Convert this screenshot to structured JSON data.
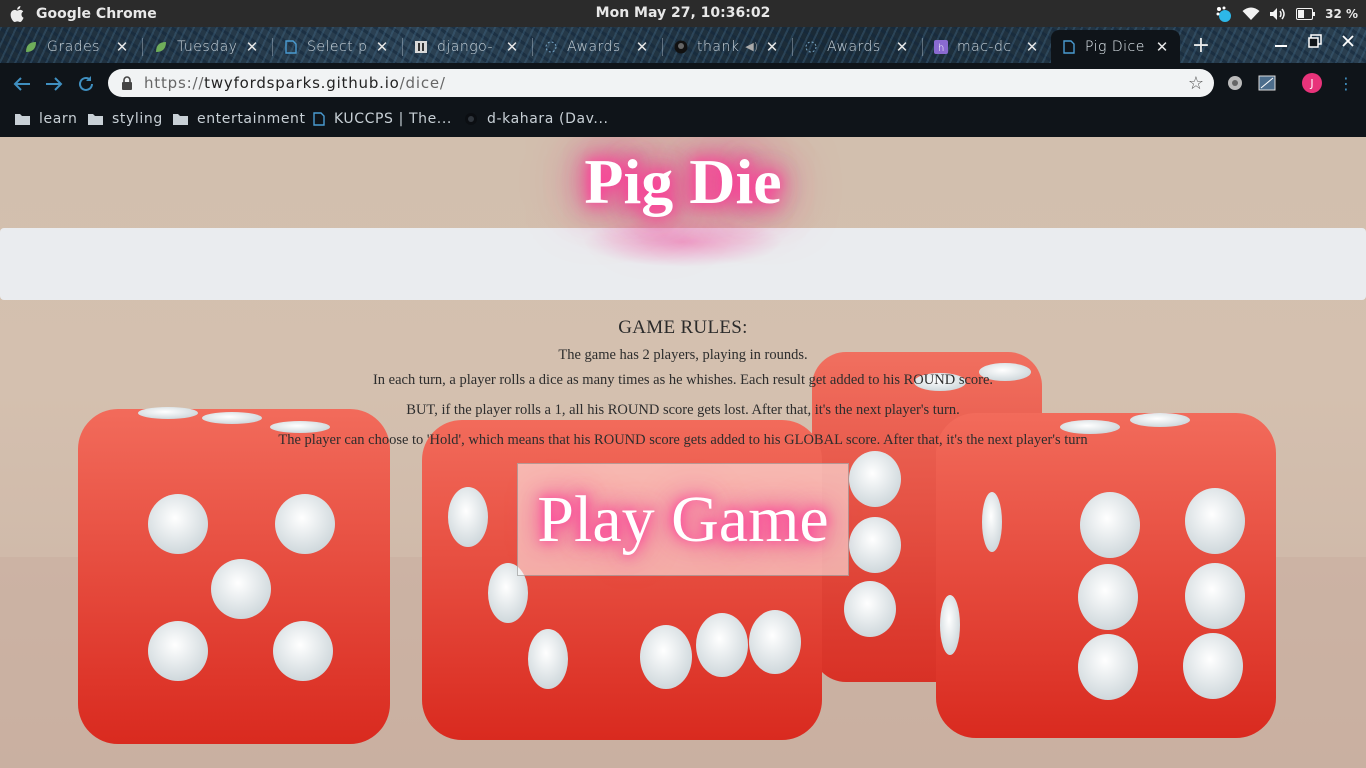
{
  "os": {
    "app_name": "Google Chrome",
    "clock": "Mon May 27, 10:36:02",
    "battery": "32 %"
  },
  "tabs": [
    {
      "title": "Grades",
      "icon": "leaf-icon"
    },
    {
      "title": "Tuesday",
      "icon": "leaf-icon"
    },
    {
      "title": "Select p",
      "icon": "document-icon"
    },
    {
      "title": "django-",
      "icon": "book-icon"
    },
    {
      "title": "Awards",
      "icon": "sparkle-icon"
    },
    {
      "title": "thank",
      "icon": "github-icon"
    },
    {
      "title": "Awards",
      "icon": "sparkle-icon"
    },
    {
      "title": "mac-dc",
      "icon": "heroku-icon"
    },
    {
      "title": "Pig Dice",
      "icon": "document-icon",
      "active": true
    }
  ],
  "address": {
    "protocol": "https://",
    "host": "twyfordsparks.github.io",
    "path": "/dice/",
    "avatar_letter": "J"
  },
  "bookmarks": [
    {
      "label": "learn",
      "icon": "folder-icon"
    },
    {
      "label": "styling",
      "icon": "folder-icon"
    },
    {
      "label": "entertainment",
      "icon": "folder-icon"
    },
    {
      "label": "KUCCPS | The...",
      "icon": "document-icon"
    },
    {
      "label": "d-kahara (Dav...",
      "icon": "github-icon"
    }
  ],
  "page": {
    "title": "Pig Die",
    "rules_heading": "GAME RULES:",
    "rules": [
      "The game has 2 players, playing in rounds.",
      "In each turn, a player rolls a dice as many times as he whishes. Each result get added to his ROUND score.",
      "BUT, if the player rolls a 1, all his ROUND score gets lost. After that, it's the next player's turn.",
      "The player can choose to 'Hold', which means that his ROUND score gets added to his GLOBAL score. After that, it's the next player's turn"
    ],
    "play_button": "Play Game"
  },
  "colors": {
    "neon_glow": "#ff3d9a",
    "dice_red": "#ef3b2c",
    "link_blue": "#3f8fc0"
  }
}
